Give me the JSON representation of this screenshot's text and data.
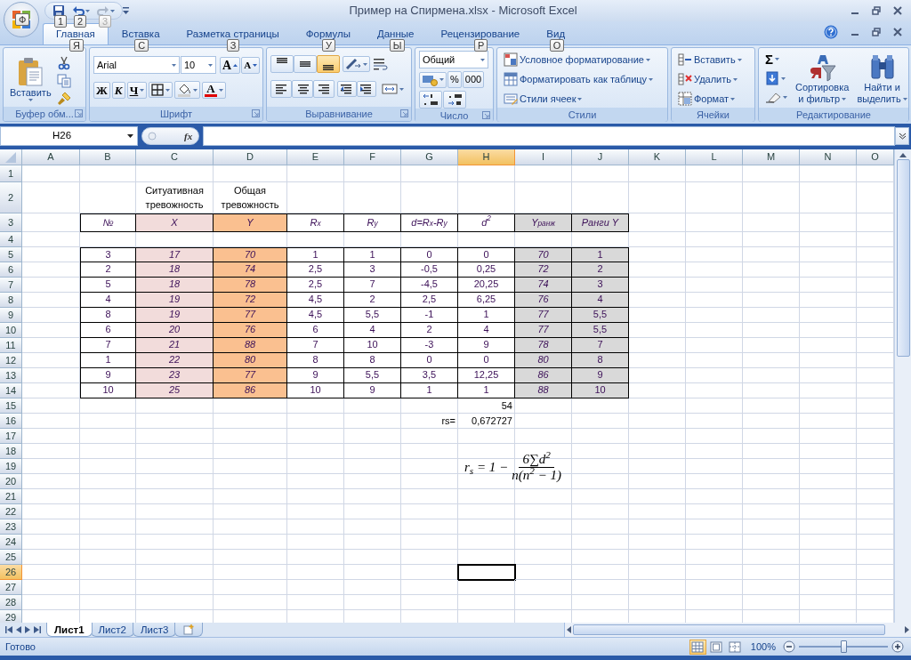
{
  "window": {
    "title": "Пример на Спирмена.xlsx - Microsoft Excel",
    "office_keytip": "Ф",
    "quick_access_keytips": [
      "1",
      "2",
      "3"
    ],
    "redo_disabled": true
  },
  "tabs": [
    {
      "label": "Главная",
      "keytip": "Я",
      "selected": true
    },
    {
      "label": "Вставка",
      "keytip": "С",
      "selected": false
    },
    {
      "label": "Разметка страницы",
      "keytip": "З",
      "selected": false
    },
    {
      "label": "Формулы",
      "keytip": "У",
      "selected": false
    },
    {
      "label": "Данные",
      "keytip": "Ы",
      "selected": false
    },
    {
      "label": "Рецензирование",
      "keytip": "Р",
      "selected": false
    },
    {
      "label": "Вид",
      "keytip": "О",
      "selected": false
    }
  ],
  "clipboard": {
    "title": "Буфер обм...",
    "paste": "Вставить"
  },
  "font": {
    "title": "Шрифт",
    "name": "Arial",
    "size": "10",
    "grow": "A",
    "shrink": "A",
    "bold": "Ж",
    "italic": "К",
    "underline": "Ч",
    "color_letter": "A"
  },
  "alignment": {
    "title": "Выравнивание",
    "vertical": [
      {
        "selected": false
      },
      {
        "selected": false
      },
      {
        "selected": true
      }
    ]
  },
  "number": {
    "title": "Число",
    "format": "Общий",
    "percent": "%",
    "thousands": "000"
  },
  "styles": {
    "title": "Стили",
    "items": [
      "Условное форматирование",
      "Форматировать как таблицу",
      "Стили ячеек"
    ]
  },
  "cells": {
    "title": "Ячейки",
    "items": [
      "Вставить",
      "Удалить",
      "Формат"
    ]
  },
  "editing": {
    "title": "Редактирование",
    "autosum": "Σ",
    "sort": [
      "Сортировка",
      "и фильтр"
    ],
    "find": [
      "Найти и",
      "выделить"
    ]
  },
  "formula_bar": {
    "name_box": "H26",
    "fx": "fx"
  },
  "sheet": {
    "columns": [
      {
        "label": "A",
        "selected": false
      },
      {
        "label": "B",
        "selected": false
      },
      {
        "label": "C",
        "selected": false
      },
      {
        "label": "D",
        "selected": false
      },
      {
        "label": "E",
        "selected": false
      },
      {
        "label": "F",
        "selected": false
      },
      {
        "label": "G",
        "selected": false
      },
      {
        "label": "H",
        "selected": true
      },
      {
        "label": "I",
        "selected": false
      },
      {
        "label": "J",
        "selected": false
      },
      {
        "label": "K",
        "selected": false
      },
      {
        "label": "L",
        "selected": false
      },
      {
        "label": "M",
        "selected": false
      },
      {
        "label": "N",
        "selected": false
      },
      {
        "label": "O",
        "selected": false
      }
    ],
    "rows": [
      {
        "label": "1",
        "selected": false
      },
      {
        "label": "2",
        "selected": false
      },
      {
        "label": "3",
        "selected": false
      },
      {
        "label": "4",
        "selected": false
      },
      {
        "label": "5",
        "selected": false
      },
      {
        "label": "6",
        "selected": false
      },
      {
        "label": "7",
        "selected": false
      },
      {
        "label": "8",
        "selected": false
      },
      {
        "label": "9",
        "selected": false
      },
      {
        "label": "10",
        "selected": false
      },
      {
        "label": "11",
        "selected": false
      },
      {
        "label": "12",
        "selected": false
      },
      {
        "label": "13",
        "selected": false
      },
      {
        "label": "14",
        "selected": false
      },
      {
        "label": "15",
        "selected": false
      },
      {
        "label": "16",
        "selected": false
      },
      {
        "label": "17",
        "selected": false
      },
      {
        "label": "18",
        "selected": false
      },
      {
        "label": "19",
        "selected": false
      },
      {
        "label": "20",
        "selected": false
      },
      {
        "label": "21",
        "selected": false
      },
      {
        "label": "22",
        "selected": false
      },
      {
        "label": "23",
        "selected": false
      },
      {
        "label": "24",
        "selected": false
      },
      {
        "label": "25",
        "selected": false
      },
      {
        "label": "26",
        "selected": true
      },
      {
        "label": "27",
        "selected": false
      },
      {
        "label": "28",
        "selected": false
      },
      {
        "label": "29",
        "selected": false
      }
    ]
  },
  "table": {
    "columns": [
      {
        "title": "№",
        "italic": false
      },
      {
        "title": "X",
        "caption": "Ситуативная тревожность",
        "color": "#f2dcdb",
        "italic": true
      },
      {
        "title": "Y",
        "caption": "Общая тревожность",
        "color": "#fac090",
        "italic": true
      },
      {
        "title": "R$_{x}$",
        "italic": false
      },
      {
        "title": "R$_{y}$",
        "italic": false
      },
      {
        "title": "d=R$_{x}$-R$_{y}$",
        "italic": false
      },
      {
        "title": "d$^{2}$",
        "italic": false
      },
      {
        "title": "Y$_{ранж}$",
        "color": "#d9d9d9",
        "italic": true
      },
      {
        "title": "Ранги Y",
        "color": "#d9d9d9",
        "italic": false
      }
    ],
    "rows": [
      [
        "3",
        "17",
        "70",
        "1",
        "1",
        "0",
        "0",
        "70",
        "1"
      ],
      [
        "2",
        "18",
        "74",
        "2,5",
        "3",
        "-0,5",
        "0,25",
        "72",
        "2"
      ],
      [
        "5",
        "18",
        "78",
        "2,5",
        "7",
        "-4,5",
        "20,25",
        "74",
        "3"
      ],
      [
        "4",
        "19",
        "72",
        "4,5",
        "2",
        "2,5",
        "6,25",
        "76",
        "4"
      ],
      [
        "8",
        "19",
        "77",
        "4,5",
        "5,5",
        "-1",
        "1",
        "77",
        "5,5"
      ],
      [
        "6",
        "20",
        "76",
        "6",
        "4",
        "2",
        "4",
        "77",
        "5,5"
      ],
      [
        "7",
        "21",
        "88",
        "7",
        "10",
        "-3",
        "9",
        "78",
        "7"
      ],
      [
        "1",
        "22",
        "80",
        "8",
        "8",
        "0",
        "0",
        "80",
        "8"
      ],
      [
        "9",
        "23",
        "77",
        "9",
        "5,5",
        "3,5",
        "12,25",
        "86",
        "9"
      ],
      [
        "10",
        "25",
        "86",
        "10",
        "9",
        "1",
        "1",
        "88",
        "10"
      ]
    ]
  },
  "summary": {
    "sum": "54",
    "label": "rs=",
    "value": "0,672727"
  },
  "formula": {
    "lhs": "r$_{s}$ = 1 −",
    "numerator": "6∑d$^{2}$",
    "denominator": "n(n$^{2}$ − 1)"
  },
  "sheet_tabs": [
    {
      "label": "Лист1",
      "selected": true
    },
    {
      "label": "Лист2",
      "selected": false
    },
    {
      "label": "Лист3",
      "selected": false
    }
  ],
  "status_bar": {
    "text": "Готово",
    "views": [
      {
        "selected": true
      },
      {
        "selected": false
      },
      {
        "selected": false
      }
    ],
    "zoom": "100%",
    "zoom_slider": {
      "level": 0.5
    }
  }
}
